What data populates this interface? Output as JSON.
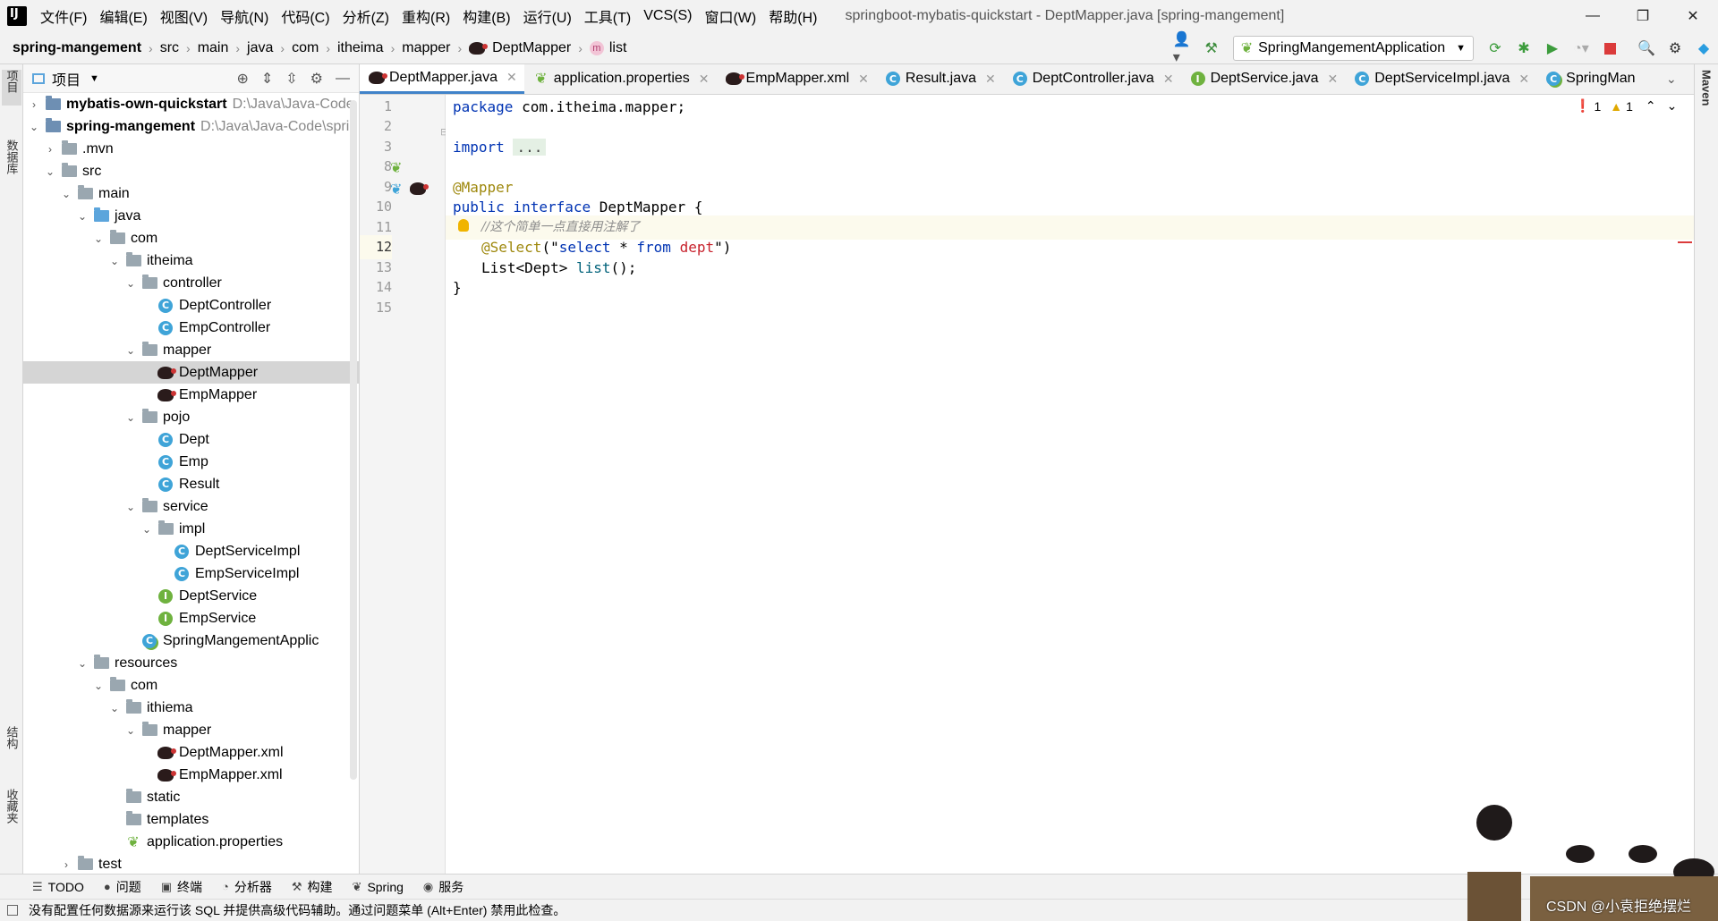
{
  "menu": {
    "items": [
      "文件(F)",
      "编辑(E)",
      "视图(V)",
      "导航(N)",
      "代码(C)",
      "分析(Z)",
      "重构(R)",
      "构建(B)",
      "运行(U)",
      "工具(T)",
      "VCS(S)",
      "窗口(W)",
      "帮助(H)"
    ],
    "window_title": "springboot-mybatis-quickstart - DeptMapper.java [spring-mangement]"
  },
  "breadcrumb": [
    "spring-mangement",
    "src",
    "main",
    "java",
    "com",
    "itheima",
    "mapper",
    "DeptMapper",
    "list"
  ],
  "run_config": "SpringMangementApplication",
  "left_strip": {
    "project": "项目",
    "database": "数据库",
    "structure": "结构",
    "favorites": "收藏夹"
  },
  "right_strip": {
    "maven": "Maven"
  },
  "project_panel": {
    "title": "项目"
  },
  "tree": [
    {
      "label": "mybatis-own-quickstart",
      "path": "D:\\Java\\Java-Code",
      "depth": 0,
      "arrow": "›",
      "icon": "module",
      "bold": true
    },
    {
      "label": "spring-mangement",
      "path": "D:\\Java\\Java-Code\\spri",
      "depth": 0,
      "arrow": "⌄",
      "icon": "module",
      "bold": true
    },
    {
      "label": ".mvn",
      "depth": 1,
      "arrow": "›",
      "icon": "folder"
    },
    {
      "label": "src",
      "depth": 1,
      "arrow": "⌄",
      "icon": "folder"
    },
    {
      "label": "main",
      "depth": 2,
      "arrow": "⌄",
      "icon": "folder"
    },
    {
      "label": "java",
      "depth": 3,
      "arrow": "⌄",
      "icon": "folder-blue"
    },
    {
      "label": "com",
      "depth": 4,
      "arrow": "⌄",
      "icon": "folder"
    },
    {
      "label": "itheima",
      "depth": 5,
      "arrow": "⌄",
      "icon": "folder"
    },
    {
      "label": "controller",
      "depth": 6,
      "arrow": "⌄",
      "icon": "folder"
    },
    {
      "label": "DeptController",
      "depth": 7,
      "icon": "class"
    },
    {
      "label": "EmpController",
      "depth": 7,
      "icon": "class"
    },
    {
      "label": "mapper",
      "depth": 6,
      "arrow": "⌄",
      "icon": "folder"
    },
    {
      "label": "DeptMapper",
      "depth": 7,
      "icon": "mybatis",
      "selected": true
    },
    {
      "label": "EmpMapper",
      "depth": 7,
      "icon": "mybatis"
    },
    {
      "label": "pojo",
      "depth": 6,
      "arrow": "⌄",
      "icon": "folder"
    },
    {
      "label": "Dept",
      "depth": 7,
      "icon": "class"
    },
    {
      "label": "Emp",
      "depth": 7,
      "icon": "class"
    },
    {
      "label": "Result",
      "depth": 7,
      "icon": "class"
    },
    {
      "label": "service",
      "depth": 6,
      "arrow": "⌄",
      "icon": "folder"
    },
    {
      "label": "impl",
      "depth": 7,
      "arrow": "⌄",
      "icon": "folder"
    },
    {
      "label": "DeptServiceImpl",
      "depth": 8,
      "icon": "class"
    },
    {
      "label": "EmpServiceImpl",
      "depth": 8,
      "icon": "class"
    },
    {
      "label": "DeptService",
      "depth": 7,
      "icon": "interface"
    },
    {
      "label": "EmpService",
      "depth": 7,
      "icon": "interface"
    },
    {
      "label": "SpringMangementApplic",
      "depth": 6,
      "icon": "spring-class"
    },
    {
      "label": "resources",
      "depth": 3,
      "arrow": "⌄",
      "icon": "folder"
    },
    {
      "label": "com",
      "depth": 4,
      "arrow": "⌄",
      "icon": "folder"
    },
    {
      "label": "ithiema",
      "depth": 5,
      "arrow": "⌄",
      "icon": "folder"
    },
    {
      "label": "mapper",
      "depth": 6,
      "arrow": "⌄",
      "icon": "folder"
    },
    {
      "label": "DeptMapper.xml",
      "depth": 7,
      "icon": "mybatis"
    },
    {
      "label": "EmpMapper.xml",
      "depth": 7,
      "icon": "mybatis"
    },
    {
      "label": "static",
      "depth": 5,
      "icon": "folder"
    },
    {
      "label": "templates",
      "depth": 5,
      "icon": "folder"
    },
    {
      "label": "application.properties",
      "depth": 5,
      "icon": "properties"
    },
    {
      "label": "test",
      "depth": 2,
      "arrow": "›",
      "icon": "folder"
    }
  ],
  "tabs": [
    {
      "label": "DeptMapper.java",
      "icon": "mybatis",
      "active": true
    },
    {
      "label": "application.properties",
      "icon": "properties"
    },
    {
      "label": "EmpMapper.xml",
      "icon": "mybatis"
    },
    {
      "label": "Result.java",
      "icon": "class"
    },
    {
      "label": "DeptController.java",
      "icon": "class"
    },
    {
      "label": "DeptService.java",
      "icon": "interface"
    },
    {
      "label": "DeptServiceImpl.java",
      "icon": "class"
    },
    {
      "label": "SpringMan",
      "icon": "spring-class"
    }
  ],
  "line_numbers": [
    "1",
    "2",
    "3",
    "8",
    "9",
    "10",
    "11",
    "12",
    "13",
    "14",
    "15"
  ],
  "code": {
    "l1_kw": "package",
    "l1_rest": " com.itheima.mapper;",
    "l3_kw": "import",
    "l3_fold": "...",
    "l9": "@Mapper",
    "l10_kw": "public interface",
    "l10_rest": " DeptMapper {",
    "l11": "//这个简单一点直接用注解了",
    "l12_ann": "@Select",
    "l12_q1": "(\"",
    "l12_sql1": "select",
    "l12_sql2": " * ",
    "l12_sql3": "from",
    "l12_sql4": " dept",
    "l12_q2": "\")",
    "l13_a": "List<Dept> ",
    "l13_m": "list",
    "l13_b": "();",
    "l14": "}"
  },
  "inspections": {
    "errors": "1",
    "warnings": "1"
  },
  "bottom_tools": [
    {
      "label": "TODO",
      "icon": "☰"
    },
    {
      "label": "问题",
      "icon": "●"
    },
    {
      "label": "终端",
      "icon": "▣"
    },
    {
      "label": "分析器",
      "icon": "◔"
    },
    {
      "label": "构建",
      "icon": "⚒"
    },
    {
      "label": "Spring",
      "icon": "❦"
    },
    {
      "label": "服务",
      "icon": "◉"
    }
  ],
  "status": "没有配置任何数据源来运行该 SQL 并提供高级代码辅助。通过问题菜单 (Alt+Enter) 禁用此检查。",
  "watermark": "CSDN @小袁拒绝摆烂",
  "colors": {
    "accent": "#4083c9",
    "class_icon": "#3fa4d8",
    "interface_icon": "#6fb23f",
    "error": "#db3b3b",
    "warning": "#e0a800"
  }
}
